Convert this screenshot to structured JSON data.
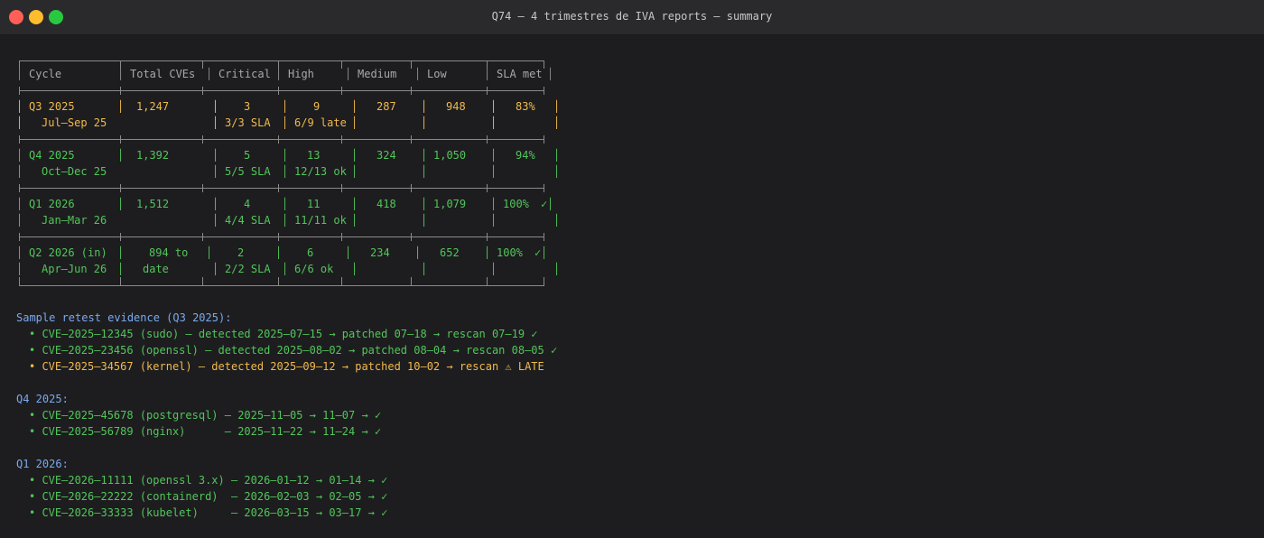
{
  "window": {
    "title": "Q74 — 4 trimestres de IVA reports — summary"
  },
  "table": {
    "headers": [
      "Cycle",
      "Total CVEs",
      "Critical",
      "High",
      "Medium",
      "Low",
      "SLA met"
    ],
    "rows": [
      {
        "cycle": "Q3 2025",
        "period": "Jul–Sep 25",
        "total": "1,247",
        "total2": "",
        "critical": "3",
        "critical_sla": "3/3 SLA",
        "high": "9",
        "high_sla": "6/9 late",
        "medium": "287",
        "low": "948",
        "sla": "83%",
        "sla_mark": ""
      },
      {
        "cycle": "Q4 2025",
        "period": "Oct–Dec 25",
        "total": "1,392",
        "total2": "",
        "critical": "5",
        "critical_sla": "5/5 SLA",
        "high": "13",
        "high_sla": "12/13 ok",
        "medium": "324",
        "low": "1,050",
        "sla": "94%",
        "sla_mark": ""
      },
      {
        "cycle": "Q1 2026",
        "period": "Jan–Mar 26",
        "total": "1,512",
        "total2": "",
        "critical": "4",
        "critical_sla": "4/4 SLA",
        "high": "11",
        "high_sla": "11/11 ok",
        "medium": "418",
        "low": "1,079",
        "sla": "100%",
        "sla_mark": "✓"
      },
      {
        "cycle": "Q2 2026 (in)",
        "period": "Apr–Jun 26",
        "total": "894 to",
        "total2": "date",
        "critical": "2",
        "critical_sla": "2/2 SLA",
        "high": "6",
        "high_sla": "6/6 ok",
        "medium": "234",
        "low": "652",
        "sla": "100%",
        "sla_mark": "✓"
      }
    ]
  },
  "evidence": {
    "q3_heading": "Sample retest evidence (Q3 2025):",
    "q3": [
      "• CVE–2025–12345 (sudo) — detected 2025–07–15 → patched 07–18 → rescan 07–19 ✓",
      "• CVE–2025–23456 (openssl) — detected 2025–08–02 → patched 08–04 → rescan 08–05 ✓",
      "• CVE–2025–34567 (kernel) — detected 2025–09–12 → patched 10–02 → rescan ⚠ LATE"
    ],
    "q4_heading": "Q4 2025:",
    "q4": [
      "• CVE–2025–45678 (postgresql) — 2025–11–05 → 11–07 → ✓",
      "• CVE–2025–56789 (nginx)      — 2025–11–22 → 11–24 → ✓"
    ],
    "q1_heading": "Q1 2026:",
    "q1": [
      "• CVE–2026–11111 (openssl 3.x) — 2026–01–12 → 01–14 → ✓",
      "• CVE–2026–22222 (containerd)  — 2026–02–03 → 02–05 → ✓",
      "• CVE–2026–33333 (kubelet)     — 2026–03–15 → 03–17 → ✓"
    ]
  },
  "colors": {
    "amber": "#f1b94c",
    "green": "#52c55a",
    "blue": "#7aa9f0",
    "border": "#8a8a8a"
  }
}
